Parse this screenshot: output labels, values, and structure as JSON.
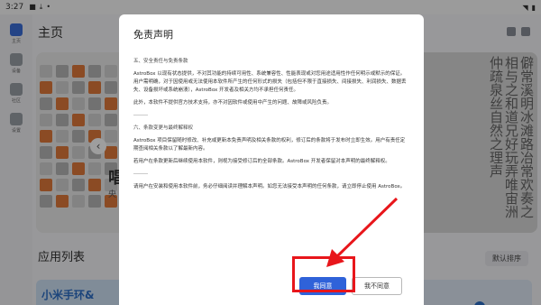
{
  "status_bar": {
    "time": "3:27"
  },
  "rail": {
    "items": [
      {
        "label": "主页",
        "active": true
      },
      {
        "label": "设备",
        "active": false
      },
      {
        "label": "社区",
        "active": false
      },
      {
        "label": "设置",
        "active": false
      }
    ]
  },
  "background": {
    "page_title": "主页",
    "banner_title": "唱",
    "banner_sub": "央",
    "chinese_wall_text": "僻常溪明冰滩路冶常欢奏之相与之和道兄好玩弄唯宙洲仲疏泉丝自然之理声",
    "applist_title": "应用列表",
    "sort_label": "默认排序",
    "app_card_text": "小米手环&"
  },
  "dialog": {
    "title": "免责声明",
    "section1_heading": "五、安全责任与免责条款",
    "section1_p1": "AstroBox 以现有状态提供，不对其功能的持续可用性、系统兼容性、性能表现或对您用途适用性作任何明示或默示的保证。用户需明确，对于因使用或无法使用本软件所产生的任何形式的损失（包括但不限于直接损失、间接损失、利润损失、数据丢失、设备损坏或系统崩溃），AstroBox 开发者及相关方均不承担任何责任。",
    "section1_p2": "此外，本软件不提供官方技术支持，亦不对因软件或使用中产生的问题、故障或风险负责。",
    "section2_heading": "六、条款变更与最终解释权",
    "section2_p1": "AstroBox 项目保留随时修改、补充或更新本免责声明及相关条款的权利，修订后的条款将于发布时立即生效。用户有责任定期查阅相关条款以了解最新内容。",
    "section2_p2": "若用户在条款更新后继续使用本软件，则视为接受修订后的全部条款。AstroBox 开发者保留对本声明的最终解释权。",
    "closing": "请用户在安装和使用本软件前，务必仔细阅读并理解本声明。如您无法接受本声明的任何条款，请立即停止使用 AstroBox。",
    "agree_label": "我同意",
    "disagree_label": "我不同意"
  },
  "annotation": {
    "color": "#e8161b"
  }
}
